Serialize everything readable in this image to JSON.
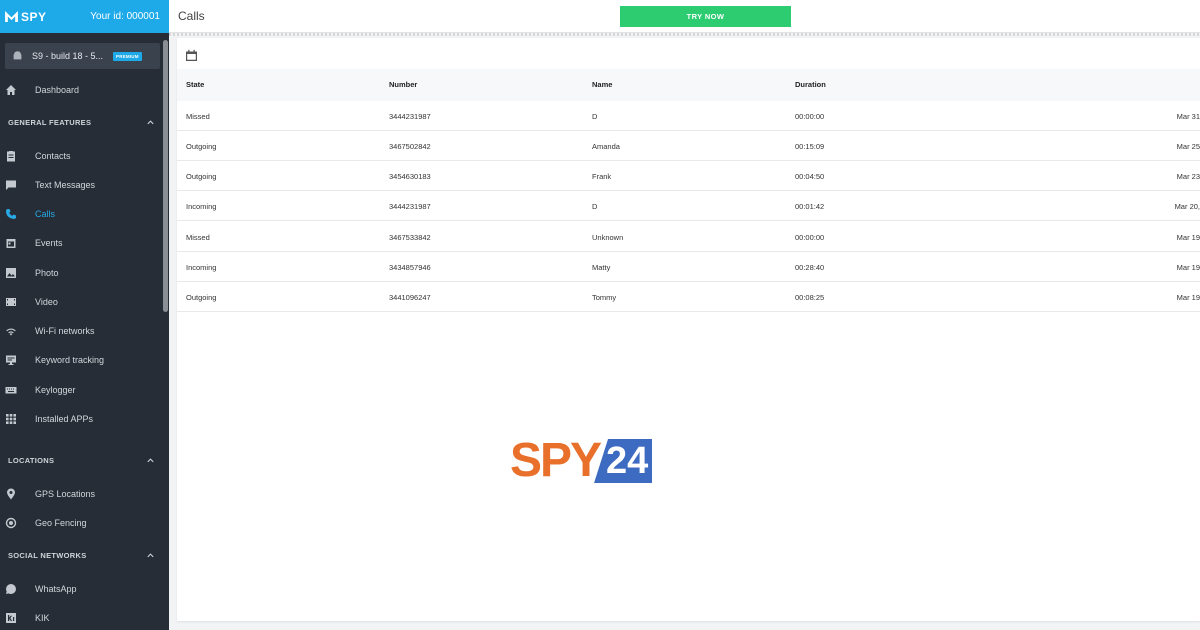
{
  "app": {
    "logo": "SPY",
    "user_id": "Your id: 000001"
  },
  "device": {
    "name": "S9 - build 18 - 5...",
    "badge": "PREMIUM"
  },
  "nav": {
    "dashboard": "Dashboard",
    "section_general": "GENERAL FEATURES",
    "contacts": "Contacts",
    "text_messages": "Text Messages",
    "calls": "Calls",
    "events": "Events",
    "photo": "Photo",
    "video": "Video",
    "wifi": "Wi-Fi networks",
    "keyword": "Keyword tracking",
    "keylogger": "Keylogger",
    "installed_apps": "Installed APPs",
    "section_locations": "LOCATIONS",
    "gps": "GPS Locations",
    "geofencing": "Geo Fencing",
    "section_social": "SOCIAL NETWORKS",
    "whatsapp": "WhatsApp",
    "kik": "KIK"
  },
  "header": {
    "title": "Calls",
    "try_now": "TRY NOW"
  },
  "table": {
    "columns": [
      "State",
      "Number",
      "Name",
      "Duration"
    ],
    "rows": [
      {
        "state": "Missed",
        "number": "3444231987",
        "name": "D",
        "duration": "00:00:00",
        "date": "Mar 31"
      },
      {
        "state": "Outgoing",
        "number": "3467502842",
        "name": "Amanda",
        "duration": "00:15:09",
        "date": "Mar 25"
      },
      {
        "state": "Outgoing",
        "number": "3454630183",
        "name": "Frank",
        "duration": "00:04:50",
        "date": "Mar 23"
      },
      {
        "state": "Incoming",
        "number": "3444231987",
        "name": "D",
        "duration": "00:01:42",
        "date": "Mar 20,"
      },
      {
        "state": "Missed",
        "number": "3467533842",
        "name": "Unknown",
        "duration": "00:00:00",
        "date": "Mar 19"
      },
      {
        "state": "Incoming",
        "number": "3434857946",
        "name": "Matty",
        "duration": "00:28:40",
        "date": "Mar 19"
      },
      {
        "state": "Outgoing",
        "number": "3441096247",
        "name": "Tommy",
        "duration": "00:08:25",
        "date": "Mar 19"
      }
    ]
  },
  "watermark": {
    "left": "SPY",
    "right": "24"
  },
  "colors": {
    "accent": "#1ea9e8",
    "sidebar": "#262d36",
    "cta": "#2ecc71",
    "watermark_orange": "#e8702a",
    "watermark_blue": "#3d6bc2"
  }
}
